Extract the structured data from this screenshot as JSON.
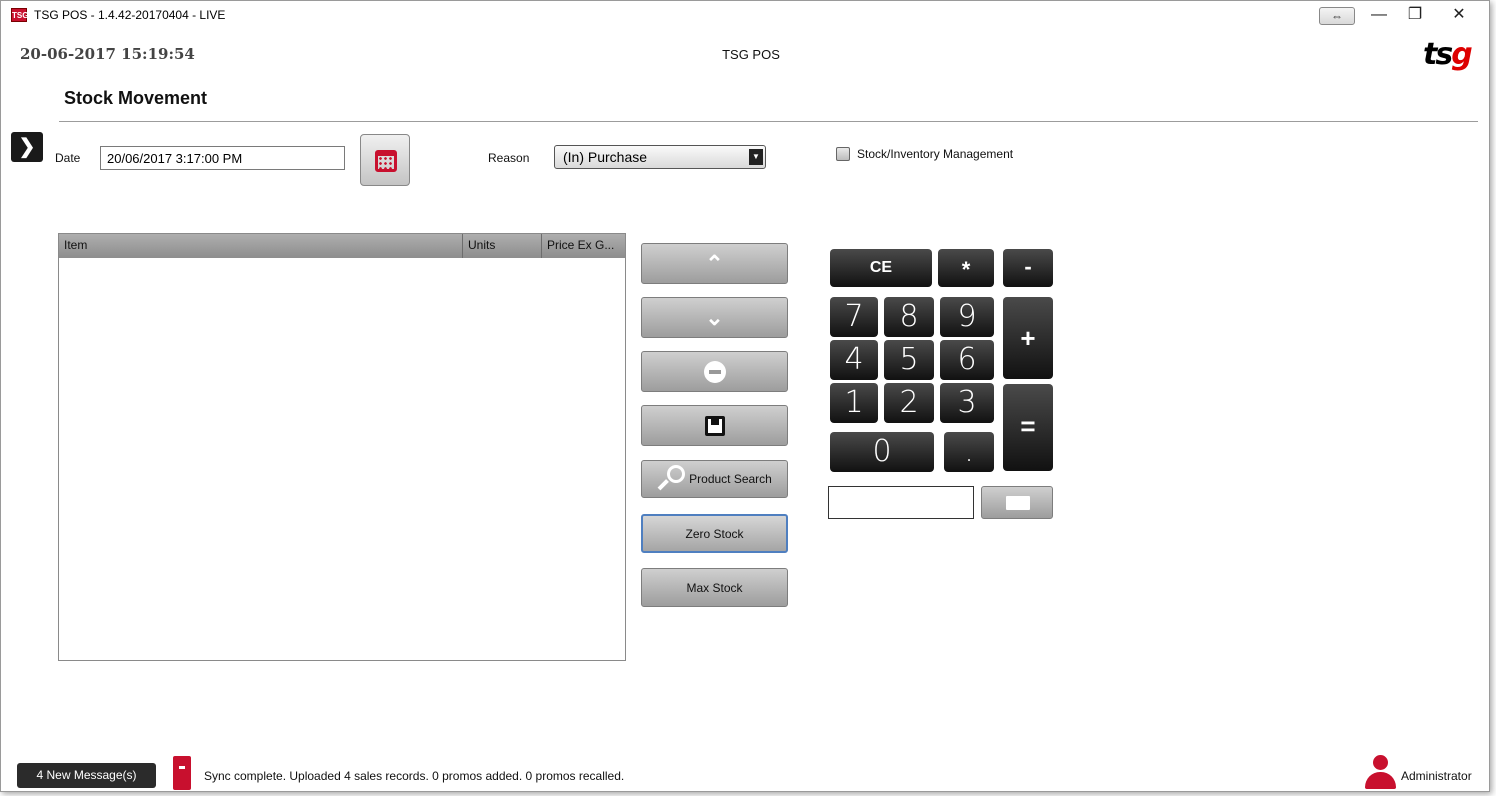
{
  "window": {
    "title": "TSG POS - 1.4.42-20170404 - LIVE",
    "app_icon_text": "TSG",
    "minimize_glyph": "—",
    "restore_glyph": "❐",
    "close_glyph": "✕",
    "snap_glyph": "⇔"
  },
  "header": {
    "datetime": "20-06-2017 15:19:54",
    "center_title": "TSG POS",
    "logo_main": "ts",
    "logo_accent": "g"
  },
  "page": {
    "title": "Stock Movement",
    "sidebar_toggle_glyph": "❯"
  },
  "form": {
    "date_label": "Date",
    "date_value": "20/06/2017 3:17:00 PM",
    "reason_label": "Reason",
    "reason_value": "(In) Purchase",
    "reason_arrow": "▼",
    "stock_mgmt_label": "Stock/Inventory Management",
    "stock_mgmt_checked": false
  },
  "table": {
    "columns": [
      "Item",
      "Units",
      "Price Ex G..."
    ],
    "rows": []
  },
  "actions": {
    "up_glyph": "⌃",
    "down_glyph": "⌄",
    "product_search": "Product Search",
    "zero_stock": "Zero Stock",
    "max_stock": "Max Stock"
  },
  "keypad": {
    "ce": "CE",
    "multiply": "*",
    "minus": "-",
    "plus": "+",
    "equals": "=",
    "d7": "7",
    "d8": "8",
    "d9": "9",
    "d4": "4",
    "d5": "5",
    "d6": "6",
    "d1": "1",
    "d2": "2",
    "d3": "3",
    "d0": "0",
    "dot": ".",
    "entry_value": ""
  },
  "status": {
    "messages_button": "4 New Message(s)",
    "sync_text": "Sync complete.  Uploaded 4 sales records. 0 promos added. 0 promos recalled.",
    "user": "Administrator"
  },
  "colors": {
    "brand_red": "#c8102e",
    "focus_blue": "#4f7fc0"
  }
}
